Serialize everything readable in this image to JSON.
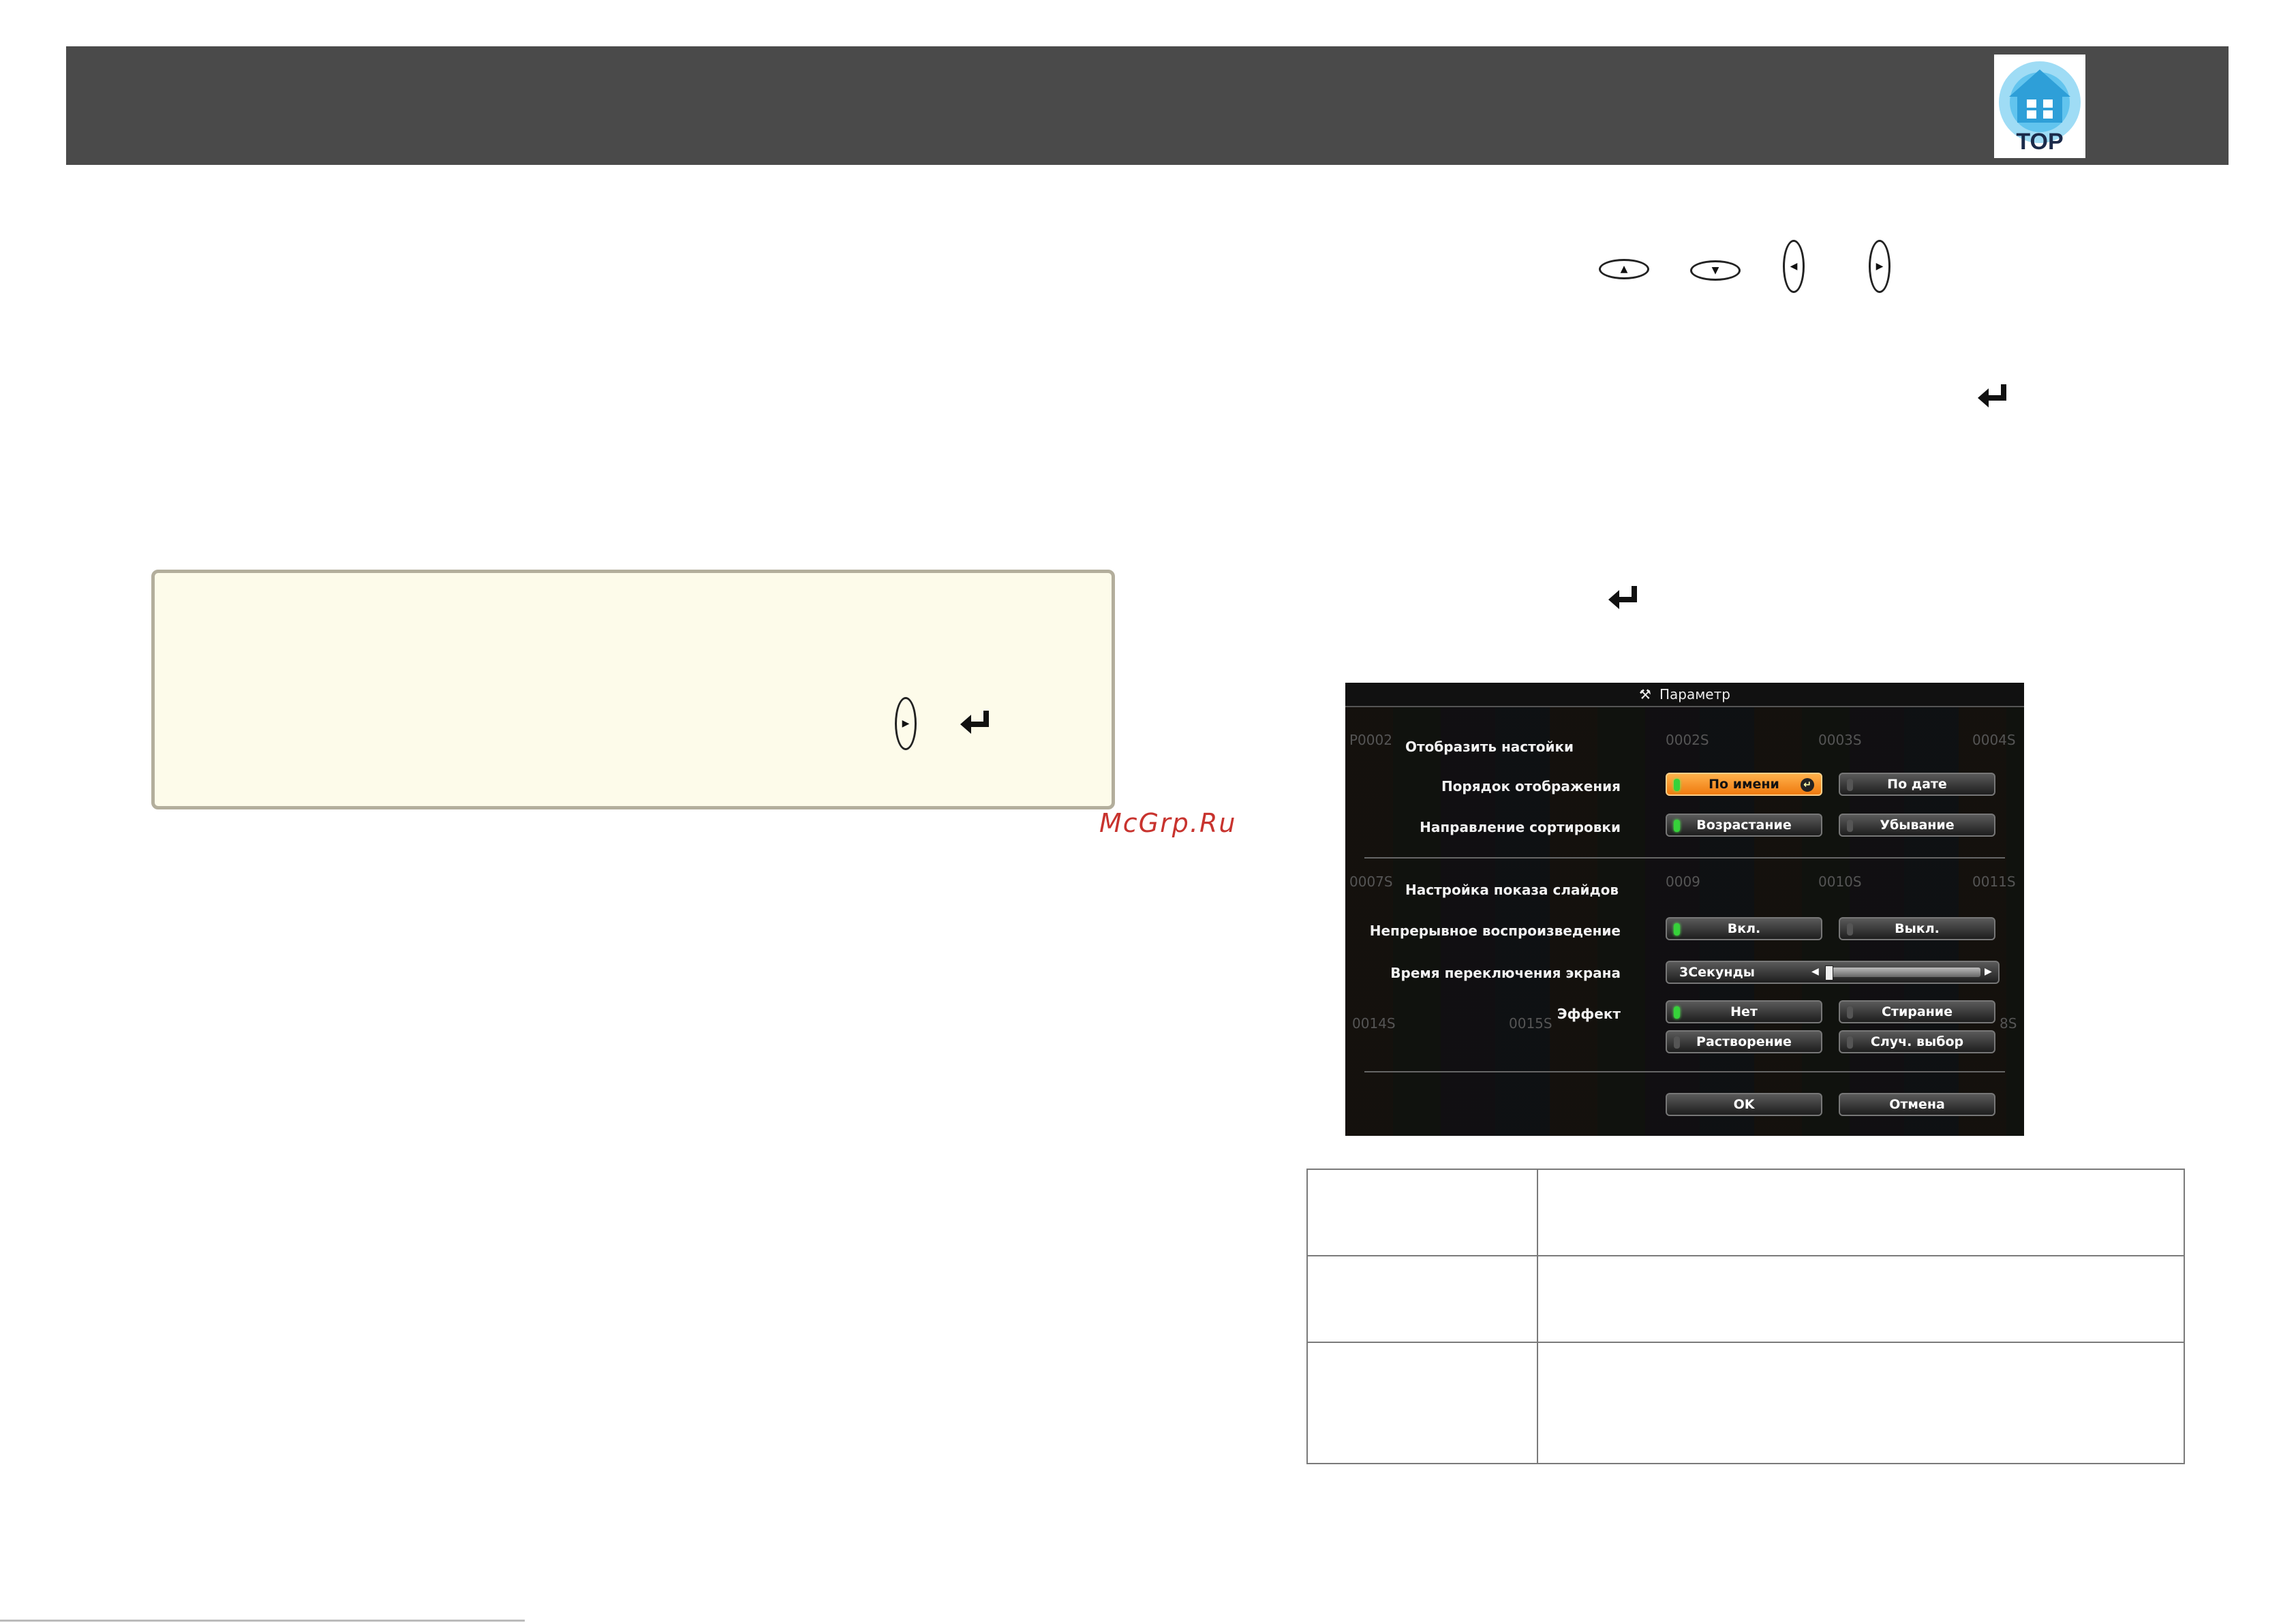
{
  "header": {
    "logo_text": "TOP"
  },
  "keys": {
    "up": "▲",
    "down": "▼",
    "left": "◀",
    "right": "▶"
  },
  "watermark": "McGrp.Ru",
  "dialog": {
    "title": "Параметр",
    "background_labels": [
      "P0002",
      "0002S",
      "0003S",
      "0004S",
      "0007S",
      "0009",
      "0010S",
      "0011S",
      "0014S",
      "0015S",
      "8S"
    ],
    "section_display": "Отобразить настойки",
    "display_order_label": "Порядок отображения",
    "display_order_options": [
      "По имени",
      "По дате"
    ],
    "sort_direction_label": "Направление сортировки",
    "sort_direction_options": [
      "Возрастание",
      "Убывание"
    ],
    "section_slideshow": "Настройка показа слайдов",
    "continuous_play_label": "Непрерывное воспроизведение",
    "continuous_play_options": [
      "Вкл.",
      "Выкл."
    ],
    "switch_time_label": "Время переключения экрана",
    "switch_time_value": "3Секунды",
    "effect_label": "Эффект",
    "effect_options": [
      "Нет",
      "Стирание",
      "Растворение",
      "Случ. выбор"
    ],
    "ok_label": "OK",
    "cancel_label": "Отмена"
  },
  "colors": {
    "header_bg": "#4a4a4a",
    "note_bg": "#fdfbea",
    "note_border": "#b3ae9c",
    "selected_button": "#ef7a10",
    "led_on": "#36d23a",
    "watermark": "#c8332e"
  }
}
